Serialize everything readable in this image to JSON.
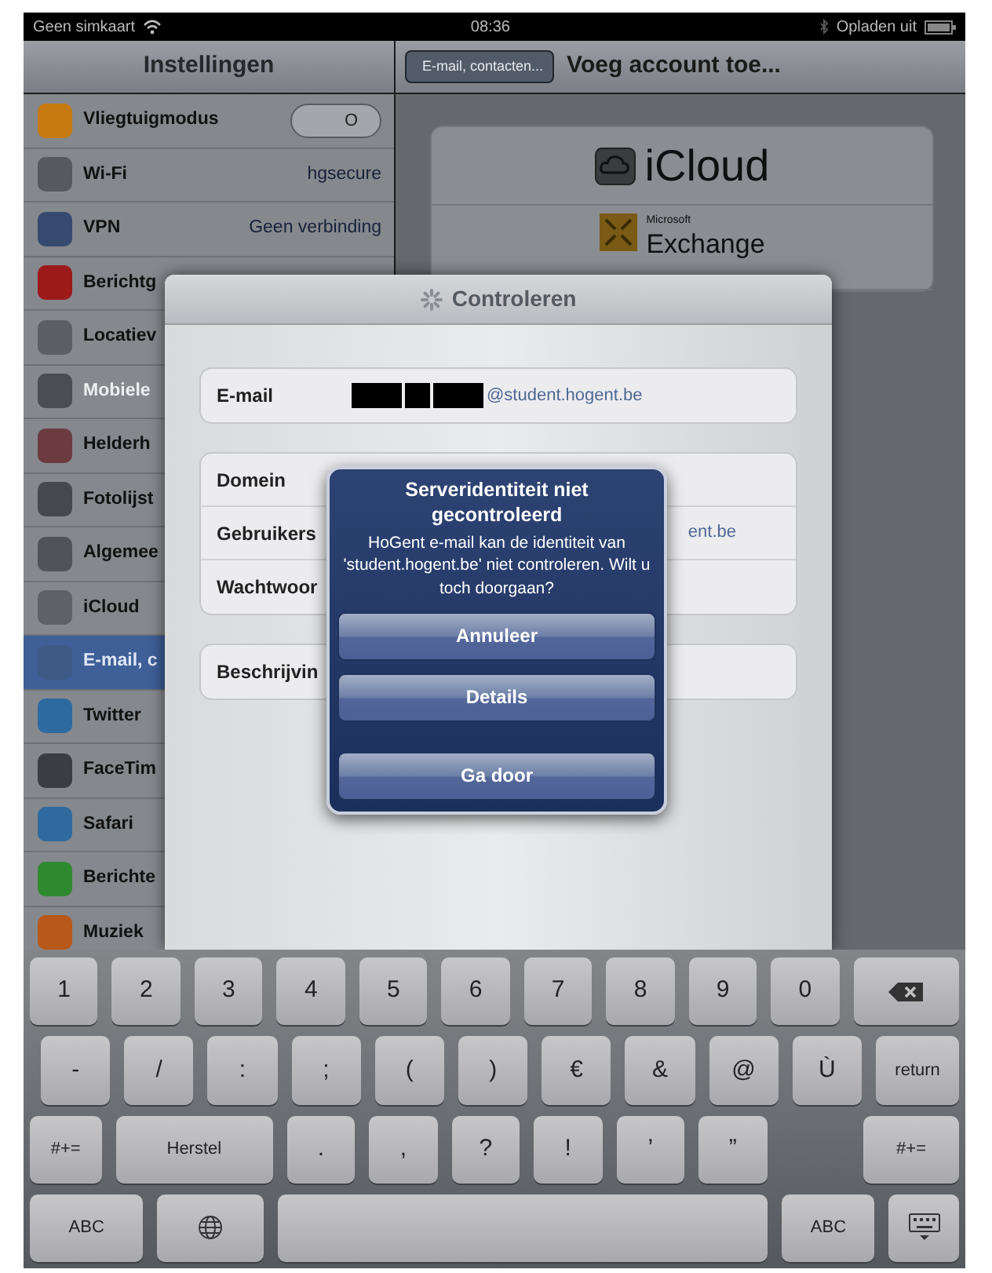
{
  "status_bar": {
    "carrier": "Geen simkaart",
    "time": "08:36",
    "charging": "Opladen uit"
  },
  "sidebar": {
    "title": "Instellingen",
    "items": [
      {
        "label": "Vliegtuigmodus",
        "kind": "toggle",
        "on": false,
        "toggle_label": "O",
        "color": "#c77a10",
        "selected": false,
        "disabled": false
      },
      {
        "label": "Wi-Fi",
        "kind": "value",
        "value": "hgsecure",
        "color": "#56595e",
        "selected": false,
        "disabled": false
      },
      {
        "label": "VPN",
        "kind": "value",
        "value": "Geen verbinding",
        "color": "#354a6e",
        "selected": false,
        "disabled": false
      },
      {
        "label": "Berichtg",
        "kind": "plain",
        "color": "#9c1a1a",
        "selected": false,
        "disabled": false
      },
      {
        "label": "Locatiev",
        "kind": "plain",
        "color": "#5b5f64",
        "selected": false,
        "disabled": false
      },
      {
        "label": "Mobiele",
        "kind": "plain",
        "color": "#4a4d52",
        "selected": false,
        "disabled": true
      },
      {
        "label": "Helderh",
        "kind": "plain",
        "color": "#6b3b40",
        "selected": false,
        "disabled": false
      },
      {
        "label": "Fotolijst",
        "kind": "plain",
        "color": "#45484d",
        "selected": false,
        "disabled": false
      },
      {
        "label": "Algemee",
        "kind": "plain",
        "color": "#50545a",
        "selected": false,
        "disabled": false
      },
      {
        "label": "iCloud",
        "kind": "plain",
        "color": "#5e6268",
        "selected": false,
        "disabled": false
      },
      {
        "label": "E-mail, c",
        "kind": "plain",
        "color": "#3e5a86",
        "selected": true,
        "disabled": false
      },
      {
        "label": "Twitter",
        "kind": "plain",
        "color": "#2d6aa0",
        "selected": false,
        "disabled": false
      },
      {
        "label": "FaceTim",
        "kind": "plain",
        "color": "#3a3d41",
        "selected": false,
        "disabled": false
      },
      {
        "label": "Safari",
        "kind": "plain",
        "color": "#2f6a9e",
        "selected": false,
        "disabled": false
      },
      {
        "label": "Berichte",
        "kind": "plain",
        "color": "#2f8a2f",
        "selected": false,
        "disabled": false
      },
      {
        "label": "Muziek",
        "kind": "plain",
        "color": "#b8581a",
        "selected": false,
        "disabled": false
      }
    ]
  },
  "detail": {
    "back": "E-mail, contacten...",
    "title": "Voeg account toe...",
    "accounts": [
      {
        "kind": "icloud",
        "name": "iCloud"
      },
      {
        "kind": "exchange",
        "vendor": "Microsoft",
        "name": "Exchange"
      }
    ]
  },
  "sheet": {
    "title": "Controleren",
    "email": {
      "label": "E-mail",
      "value": "@student.hogent.be"
    },
    "groups": [
      [
        {
          "label": "Domein"
        },
        {
          "label": "Gebruikers",
          "value": "ent.be"
        },
        {
          "label": "Wachtwoor"
        }
      ],
      [
        {
          "label": "Beschrijvin"
        }
      ]
    ]
  },
  "alert": {
    "title": "Serveridentiteit niet gecontroleerd",
    "message": "HoGent e-mail kan de identiteit van 'student.hogent.be' niet controleren. Wilt u toch doorgaan?",
    "buttons": [
      "Annuleer",
      "Details",
      "Ga door"
    ]
  },
  "keyboard": [
    [
      {
        "kind": "key",
        "label": "1"
      },
      {
        "kind": "key",
        "label": "2"
      },
      {
        "kind": "key",
        "label": "3"
      },
      {
        "kind": "key",
        "label": "4"
      },
      {
        "kind": "key",
        "label": "5"
      },
      {
        "kind": "key",
        "label": "6"
      },
      {
        "kind": "key",
        "label": "7"
      },
      {
        "kind": "key",
        "label": "8"
      },
      {
        "kind": "key",
        "label": "9"
      },
      {
        "kind": "key",
        "label": "0"
      },
      {
        "kind": "delete"
      }
    ],
    [
      {
        "kind": "key",
        "label": "-"
      },
      {
        "kind": "key",
        "label": "/"
      },
      {
        "kind": "key",
        "label": ":"
      },
      {
        "kind": "key",
        "label": ";"
      },
      {
        "kind": "key",
        "label": "("
      },
      {
        "kind": "key",
        "label": ")"
      },
      {
        "kind": "key",
        "label": "€"
      },
      {
        "kind": "key",
        "label": "&"
      },
      {
        "kind": "key",
        "label": "@"
      },
      {
        "kind": "key",
        "label": "Ù"
      },
      {
        "kind": "return",
        "label": "return"
      }
    ],
    [
      {
        "kind": "shift",
        "label": "#+="
      },
      {
        "kind": "wide",
        "label": "Herstel"
      },
      {
        "kind": "key",
        "label": "."
      },
      {
        "kind": "key",
        "label": ","
      },
      {
        "kind": "key",
        "label": "?"
      },
      {
        "kind": "key",
        "label": "!"
      },
      {
        "kind": "key",
        "label": "’"
      },
      {
        "kind": "key",
        "label": "”"
      },
      {
        "kind": "gap"
      },
      {
        "kind": "shift2",
        "label": "#+="
      }
    ],
    [
      {
        "kind": "mode",
        "label": "ABC"
      },
      {
        "kind": "globe"
      },
      {
        "kind": "space"
      },
      {
        "kind": "mode2",
        "label": "ABC"
      },
      {
        "kind": "hide"
      }
    ]
  ]
}
